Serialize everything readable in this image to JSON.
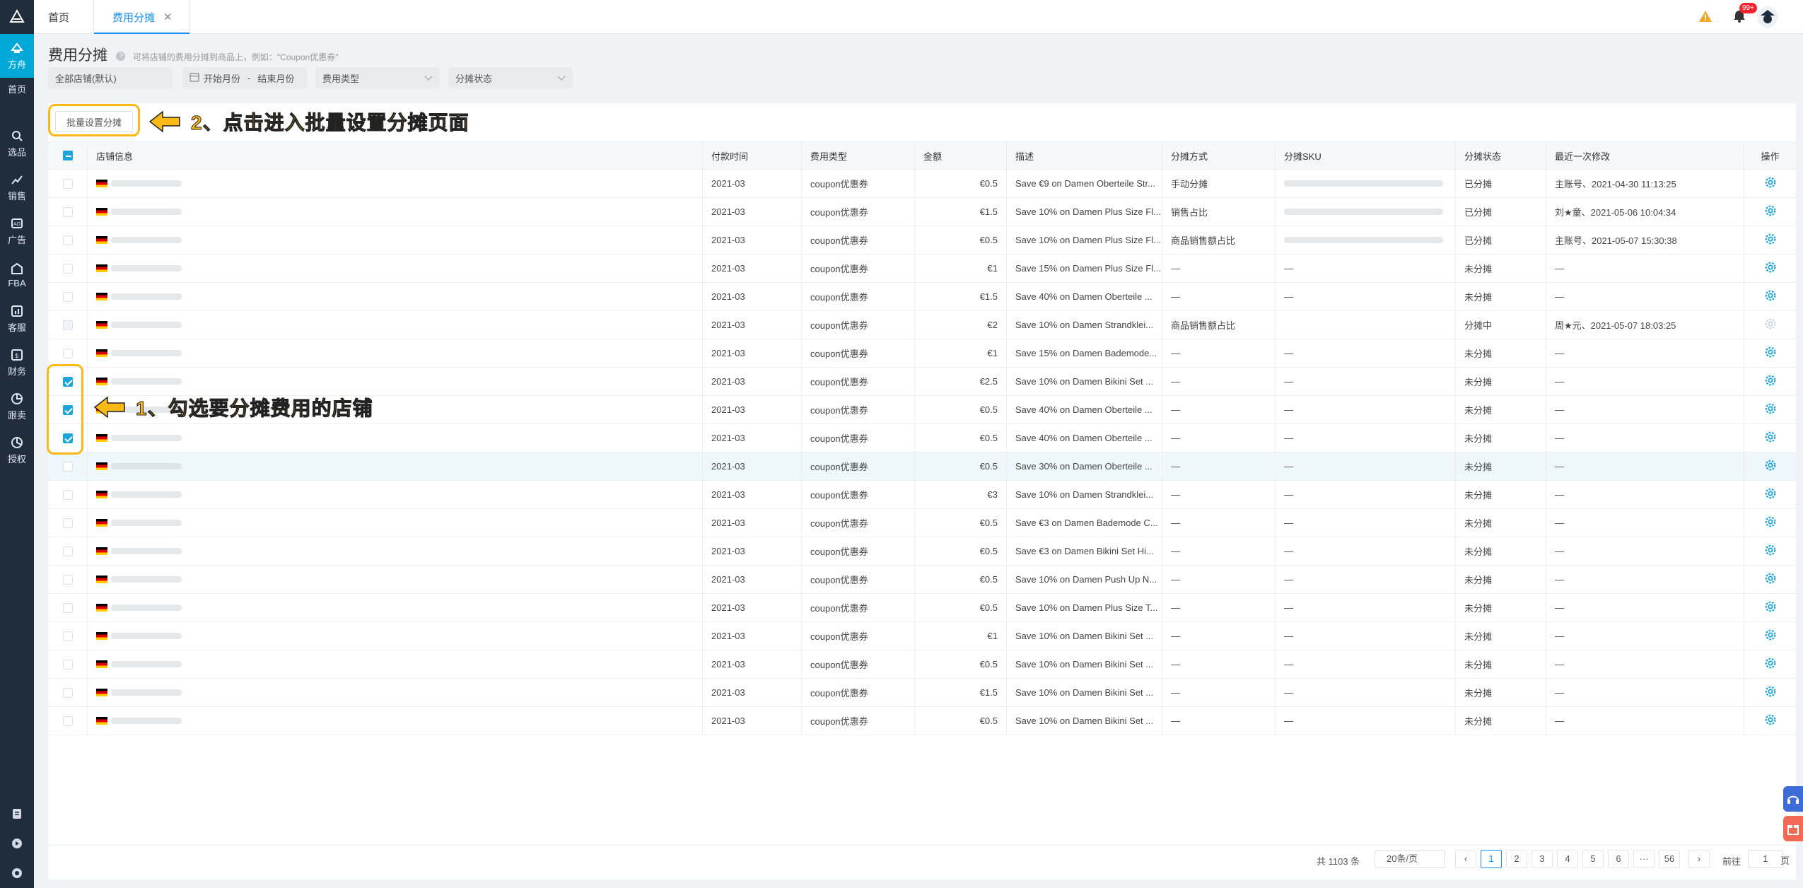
{
  "nav": {
    "items": [
      {
        "label": "方舟",
        "icon": "ark-icon"
      },
      {
        "label": "首页",
        "icon": "home-icon"
      },
      {
        "label": "选品",
        "icon": "search-icon"
      },
      {
        "label": "销售",
        "icon": "sales-chart-icon"
      },
      {
        "label": "广告",
        "icon": "ad-icon"
      },
      {
        "label": "FBA",
        "icon": "warehouse-icon"
      },
      {
        "label": "客服",
        "icon": "service-icon"
      },
      {
        "label": "财务",
        "icon": "finance-icon"
      },
      {
        "label": "跟卖",
        "icon": "follow-sell-icon"
      },
      {
        "label": "授权",
        "icon": "auth-icon"
      }
    ]
  },
  "tabs": {
    "home": "首页",
    "current": "费用分摊"
  },
  "notifications": {
    "badge": "99+"
  },
  "page": {
    "title": "费用分摊",
    "hint": "可将店铺的费用分摊到商品上，例如：\"Coupon优惠券\""
  },
  "filters": {
    "store": "全部店铺(默认)",
    "start_month": "开始月份",
    "range_sep": "-",
    "end_month": "结束月份",
    "fee_type": "费用类型",
    "status": "分摊状态"
  },
  "batch_button": "批量设置分摊",
  "annotations": {
    "step2": "2、点击进入批量设置分摊页面",
    "step1": "1、勾选要分摊费用的店铺"
  },
  "table": {
    "headers": [
      "店铺信息",
      "付款时间",
      "费用类型",
      "金额",
      "描述",
      "分摊方式",
      "分摊SKU",
      "分摊状态",
      "最近一次修改",
      "操作"
    ],
    "rows": [
      {
        "checked": false,
        "disabled": false,
        "time": "2021-03",
        "type": "coupon优惠券",
        "amount": "€0.5",
        "desc": "Save €9 on Damen Oberteile Str...",
        "method": "手动分摊",
        "sku_blurred": true,
        "status": "已分摊",
        "modified": "主账号、2021-04-30 11:13:25"
      },
      {
        "checked": false,
        "disabled": false,
        "time": "2021-03",
        "type": "coupon优惠券",
        "amount": "€1.5",
        "desc": "Save 10% on Damen Plus Size Fl...",
        "method": "销售占比",
        "sku_blurred": true,
        "status": "已分摊",
        "modified": "刘★童、2021-05-06 10:04:34"
      },
      {
        "checked": false,
        "disabled": false,
        "time": "2021-03",
        "type": "coupon优惠券",
        "amount": "€0.5",
        "desc": "Save 10% on Damen Plus Size Fl...",
        "method": "商品销售额占比",
        "sku_blurred": true,
        "status": "已分摊",
        "modified": "主账号、2021-05-07 15:30:38"
      },
      {
        "checked": false,
        "disabled": false,
        "time": "2021-03",
        "type": "coupon优惠券",
        "amount": "€1",
        "desc": "Save 15% on Damen Plus Size Fl...",
        "method": "—",
        "sku": "—",
        "status": "未分摊",
        "modified": "—"
      },
      {
        "checked": false,
        "disabled": false,
        "time": "2021-03",
        "type": "coupon优惠券",
        "amount": "€1.5",
        "desc": "Save 40% on Damen Oberteile ...",
        "method": "—",
        "sku": "—",
        "status": "未分摊",
        "modified": "—"
      },
      {
        "checked": false,
        "disabled": true,
        "time": "2021-03",
        "type": "coupon优惠券",
        "amount": "€2",
        "desc": "Save 10% on Damen Strandklei...",
        "method": "商品销售额占比",
        "sku": "",
        "status": "分摊中",
        "modified": "周★元、2021-05-07 18:03:25"
      },
      {
        "checked": false,
        "disabled": false,
        "time": "2021-03",
        "type": "coupon优惠券",
        "amount": "€1",
        "desc": "Save 15% on Damen Bademode...",
        "method": "—",
        "sku": "—",
        "status": "未分摊",
        "modified": "—"
      },
      {
        "checked": true,
        "disabled": false,
        "time": "2021-03",
        "type": "coupon优惠券",
        "amount": "€2.5",
        "desc": "Save 10% on Damen Bikini Set ...",
        "method": "—",
        "sku": "—",
        "status": "未分摊",
        "modified": "—"
      },
      {
        "checked": true,
        "disabled": false,
        "time": "2021-03",
        "type": "coupon优惠券",
        "amount": "€0.5",
        "desc": "Save 40% on Damen Oberteile ...",
        "method": "—",
        "sku": "—",
        "status": "未分摊",
        "modified": "—"
      },
      {
        "checked": true,
        "disabled": false,
        "time": "2021-03",
        "type": "coupon优惠券",
        "amount": "€0.5",
        "desc": "Save 40% on Damen Oberteile ...",
        "method": "—",
        "sku": "—",
        "status": "未分摊",
        "modified": "—"
      },
      {
        "checked": false,
        "disabled": false,
        "highlight": true,
        "time": "2021-03",
        "type": "coupon优惠券",
        "amount": "€0.5",
        "desc": "Save 30% on Damen Oberteile ...",
        "method": "—",
        "sku": "—",
        "status": "未分摊",
        "modified": "—"
      },
      {
        "checked": false,
        "disabled": false,
        "time": "2021-03",
        "type": "coupon优惠券",
        "amount": "€3",
        "desc": "Save 10% on Damen Strandklei...",
        "method": "—",
        "sku": "—",
        "status": "未分摊",
        "modified": "—"
      },
      {
        "checked": false,
        "disabled": false,
        "time": "2021-03",
        "type": "coupon优惠券",
        "amount": "€0.5",
        "desc": "Save €3 on Damen Bademode C...",
        "method": "—",
        "sku": "—",
        "status": "未分摊",
        "modified": "—"
      },
      {
        "checked": false,
        "disabled": false,
        "time": "2021-03",
        "type": "coupon优惠券",
        "amount": "€0.5",
        "desc": "Save €3 on Damen Bikini Set Hi...",
        "method": "—",
        "sku": "—",
        "status": "未分摊",
        "modified": "—"
      },
      {
        "checked": false,
        "disabled": false,
        "time": "2021-03",
        "type": "coupon优惠券",
        "amount": "€0.5",
        "desc": "Save 10% on Damen Push Up N...",
        "method": "—",
        "sku": "—",
        "status": "未分摊",
        "modified": "—"
      },
      {
        "checked": false,
        "disabled": false,
        "time": "2021-03",
        "type": "coupon优惠券",
        "amount": "€0.5",
        "desc": "Save 10% on Damen Plus Size T...",
        "method": "—",
        "sku": "—",
        "status": "未分摊",
        "modified": "—"
      },
      {
        "checked": false,
        "disabled": false,
        "time": "2021-03",
        "type": "coupon优惠券",
        "amount": "€1",
        "desc": "Save 10% on Damen Bikini Set ...",
        "method": "—",
        "sku": "—",
        "status": "未分摊",
        "modified": "—"
      },
      {
        "checked": false,
        "disabled": false,
        "time": "2021-03",
        "type": "coupon优惠券",
        "amount": "€0.5",
        "desc": "Save 10% on Damen Bikini Set ...",
        "method": "—",
        "sku": "—",
        "status": "未分摊",
        "modified": "—"
      },
      {
        "checked": false,
        "disabled": false,
        "time": "2021-03",
        "type": "coupon优惠券",
        "amount": "€1.5",
        "desc": "Save 10% on Damen Bikini Set ...",
        "method": "—",
        "sku": "—",
        "status": "未分摊",
        "modified": "—"
      },
      {
        "checked": false,
        "disabled": false,
        "time": "2021-03",
        "type": "coupon优惠券",
        "amount": "€0.5",
        "desc": "Save 10% on Damen Bikini Set ...",
        "method": "—",
        "sku": "—",
        "status": "未分摊",
        "modified": "—"
      }
    ]
  },
  "pagination": {
    "total": "共 1103 条",
    "page_size": "20条/页",
    "pages": [
      "1",
      "2",
      "3",
      "4",
      "5",
      "6",
      "···",
      "56"
    ],
    "current": "1",
    "goto_label": "前往",
    "goto_value": "1",
    "page_unit": "页"
  },
  "colors": {
    "accent": "#1aa6d8",
    "nav_bg": "#1f2d3d",
    "annotation": "#fbb917",
    "flag": "germany"
  }
}
